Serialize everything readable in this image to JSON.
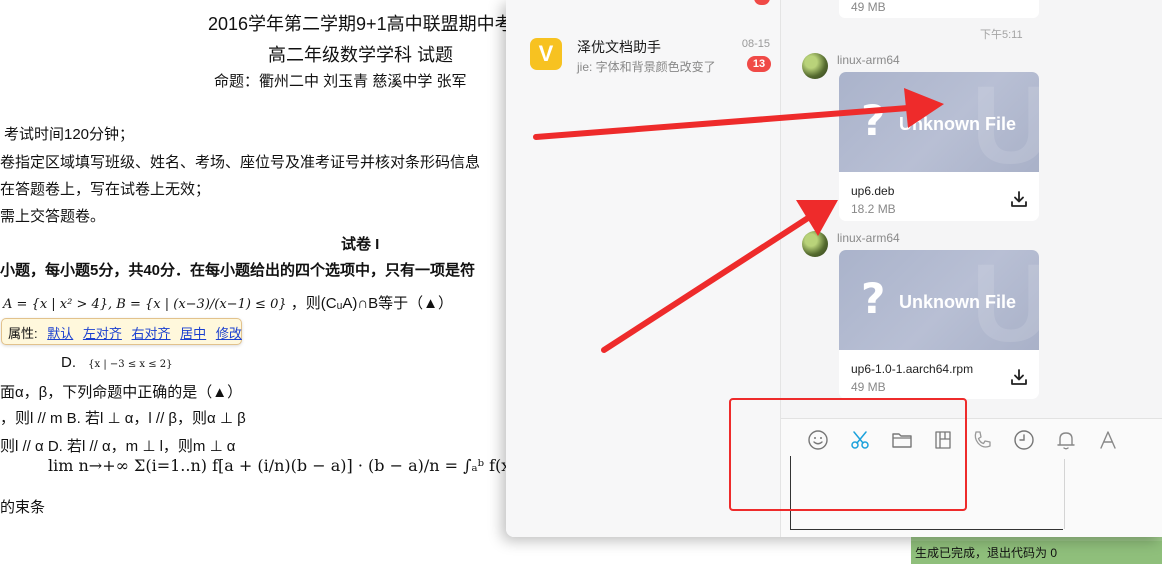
{
  "document": {
    "title_line1": "2016学年第二学期9+1高中联盟期中考",
    "title_line2": "高二年级数学学科 试题",
    "authors": "命题：衢州二中  刘玉青  慈溪中学  张军",
    "notes": [
      "考试时间120分钟；",
      "卷指定区域填写班级、姓名、考场、座位号及准考证号并核对条形码信息",
      "在答题卷上，写在试卷上无效；",
      "需上交答题卷。"
    ],
    "section_title": "试卷 I",
    "section_intro": "小题，每小题5分，共40分．在每小题给出的四个选项中，只有一项是符",
    "q1_prefix": "A = {x | x² > 4}, B = {x | (x−3)/(x−1) ≤ 0}",
    "q1_suffix": "，则(CᵤA)∩B等于（▲）",
    "q1_option_d": "D.",
    "q1_option_d_math": "{x | −3 ≤ x ≤ 2}",
    "q2_line": "面α，β，下列命题中正确的是（▲）",
    "q2_line_b": "，则l // m    B. 若l ⊥ α，l // β，则α ⊥ β",
    "q2_line_cd": "则l // α        D. 若l // α，m ⊥ l，则m ⊥ α",
    "formula_prefix": "的束条",
    "formula": "lim n→+∞ Σ(i=1..n) f[a + (i/n)(b − a)] · (b − a)/n = ∫ₐᵇ f(x)dx",
    "formula_tail": "ab"
  },
  "attr_tooltip": {
    "label": "属性:",
    "links": [
      "默认",
      "左对齐",
      "右对齐",
      "居中",
      "修改"
    ]
  },
  "terminal": {
    "text": "生成已完成，退出代码为  0"
  },
  "chat": {
    "conversation": {
      "logo_letter": "V",
      "name": "泽优文档助手",
      "preview": "jie: 字体和背景颜色改变了",
      "date": "08-15",
      "unread": "13"
    },
    "previous_file_size": "49 MB",
    "timestamp": "下午5:11",
    "messages": [
      {
        "sender": "linux-arm64",
        "thumb_label": "Unknown File",
        "file_name": "up6.deb",
        "file_size": "18.2 MB"
      },
      {
        "sender": "linux-arm64",
        "thumb_label": "Unknown File",
        "file_name": "up6-1.0-1.aarch64.rpm",
        "file_size": "49 MB"
      }
    ],
    "toolbar_icons": [
      "emoji-icon",
      "scissors-icon",
      "folder-icon",
      "document-icon",
      "phone-icon",
      "clock-icon",
      "bell-icon",
      "font-icon"
    ],
    "colors": {
      "accent_cyan": "#1aa1dc",
      "badge_red": "#f04a47",
      "annotation_red": "#ee2b2b",
      "thumb_bg": "#b0b8ce"
    }
  }
}
